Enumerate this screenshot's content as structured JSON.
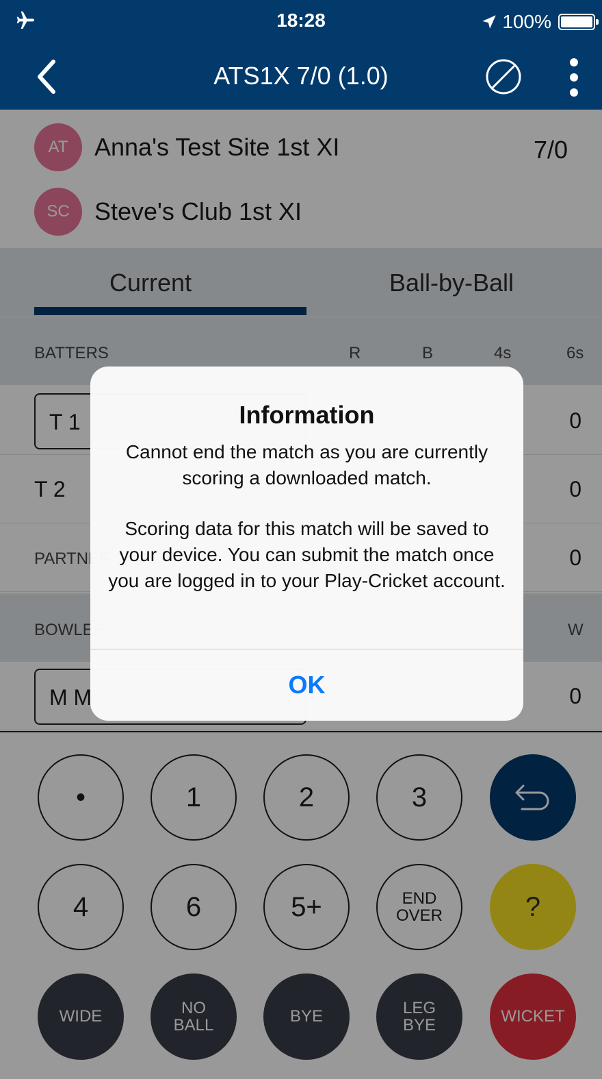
{
  "status_bar": {
    "time": "18:28",
    "battery": "100%"
  },
  "nav": {
    "title": "ATS1X 7/0 (1.0)"
  },
  "teams": [
    {
      "initials": "AT",
      "name": "Anna's Test Site 1st XI",
      "score": "7/0"
    },
    {
      "initials": "SC",
      "name": "Steve's Club 1st XI",
      "score": ""
    }
  ],
  "tabs": {
    "current": "Current",
    "ball_by_ball": "Ball-by-Ball"
  },
  "batters": {
    "header": "BATTERS",
    "columns": [
      "R",
      "B",
      "4s",
      "6s"
    ],
    "rows": [
      {
        "name": "T 1",
        "last": "0"
      },
      {
        "name": "T 2",
        "last": "0"
      }
    ],
    "partnership": {
      "label": "PARTNEF",
      "last": "0"
    }
  },
  "bowlers": {
    "header": "BOWLER",
    "last_col": "W",
    "row": {
      "name": "M M",
      "last": "0"
    }
  },
  "keypad": {
    "row1": [
      "•",
      "1",
      "2",
      "3"
    ],
    "row2": [
      "4",
      "6",
      "5+",
      "END\nOVER"
    ],
    "row2_help": "?",
    "row3": [
      "WIDE",
      "NO\nBALL",
      "BYE",
      "LEG\nBYE",
      "WICKET"
    ]
  },
  "dialog": {
    "title": "Information",
    "message1": "Cannot end the match as you are currently scoring a downloaded match.",
    "message2": "Scoring data for this match will be saved to your device. You can submit the match once you are logged in to your Play-Cricket account.",
    "ok": "OK"
  },
  "colors": {
    "brand": "#023a6c",
    "badge": "#e8769a",
    "ok": "#0a7aff",
    "wicket": "#e3303d",
    "help": "#f5e023"
  }
}
